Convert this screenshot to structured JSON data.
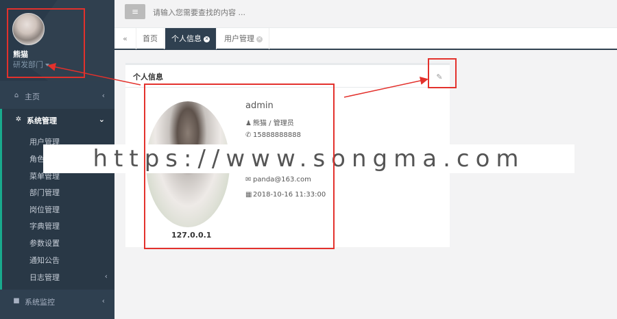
{
  "sidebar": {
    "user": {
      "name": "熊猫",
      "dept": "研发部门"
    },
    "nav": {
      "home": "主页",
      "system": "系统管理",
      "monitor": "系统监控"
    },
    "submenu": [
      "用户管理",
      "角色",
      "菜单管理",
      "部门管理",
      "岗位管理",
      "字典管理",
      "参数设置",
      "通知公告",
      "日志管理"
    ]
  },
  "topbar": {
    "search_placeholder": "请输入您需要查找的内容 ..."
  },
  "tabs": [
    "首页",
    "个人信息",
    "用户管理"
  ],
  "profile": {
    "title": "个人信息",
    "login_name": "admin",
    "name_role": "熊猫 / 管理员",
    "phone": "15888888888",
    "email": "panda@163.com",
    "created": "2018-10-16 11:33:00",
    "ip": "127.0.0.1"
  },
  "watermark": "https://www.songma.com",
  "colors": {
    "sidebar": "#2f4050",
    "accent": "#19aa8d",
    "annotation": "#e3312c"
  }
}
